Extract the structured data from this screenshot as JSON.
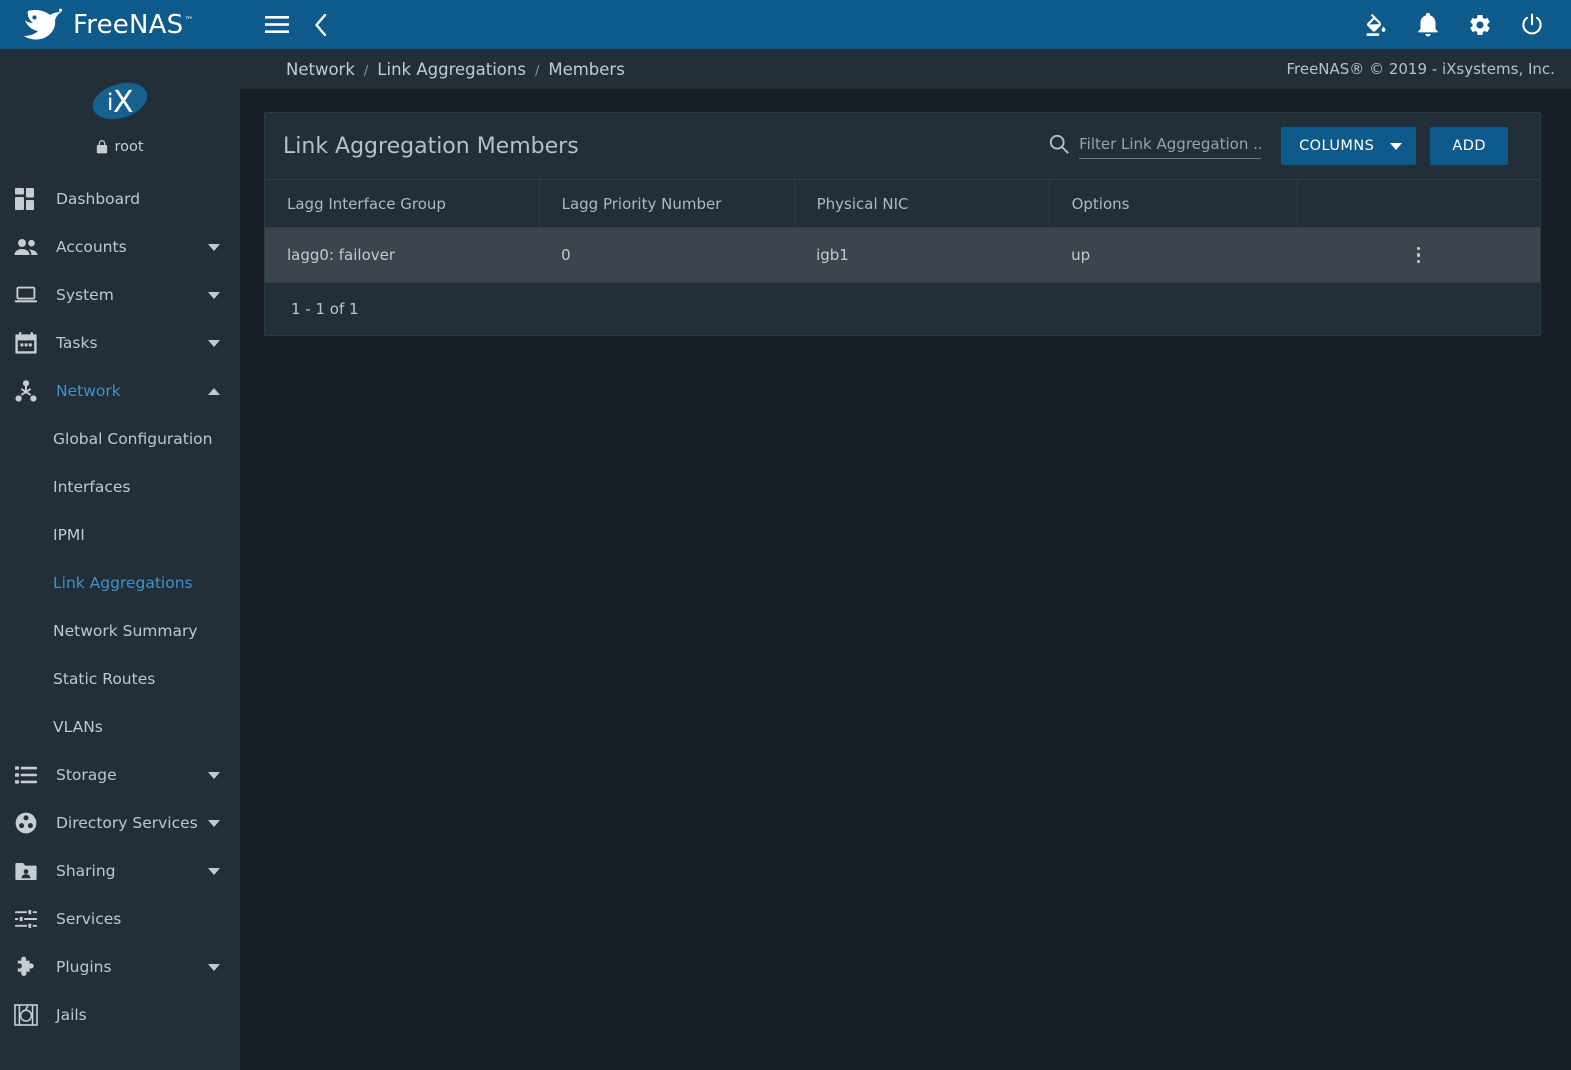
{
  "app": {
    "brand_name": "FreeNAS",
    "brand_tm": "™",
    "logo_icon": "freenas-shark-logo"
  },
  "topbar": {
    "menu_icon": "hamburger-menu-icon",
    "back_icon": "chevron-left-icon",
    "icons": [
      {
        "name": "theme-paint-bucket-icon",
        "label": "Change Theme"
      },
      {
        "name": "notifications-bell-icon",
        "label": "Notifications"
      },
      {
        "name": "settings-gear-icon",
        "label": "Settings"
      },
      {
        "name": "power-icon",
        "label": "Power"
      }
    ]
  },
  "sidebar": {
    "avatar_icon": "ix-systems-logo",
    "avatar_text": "iX",
    "lock_icon": "lock-icon",
    "username": "root",
    "items": [
      {
        "label": "Dashboard",
        "icon": "dashboard-icon",
        "expandable": false,
        "active": false
      },
      {
        "label": "Accounts",
        "icon": "accounts-people-icon",
        "expandable": true,
        "expanded": false,
        "active": false
      },
      {
        "label": "System",
        "icon": "system-laptop-icon",
        "expandable": true,
        "expanded": false,
        "active": false
      },
      {
        "label": "Tasks",
        "icon": "tasks-calendar-icon",
        "expandable": true,
        "expanded": false,
        "active": false
      },
      {
        "label": "Network",
        "icon": "network-share-icon",
        "expandable": true,
        "expanded": true,
        "active": true
      },
      {
        "label": "Storage",
        "icon": "storage-list-icon",
        "expandable": true,
        "expanded": false,
        "active": false
      },
      {
        "label": "Directory Services",
        "icon": "directory-services-icon",
        "expandable": true,
        "expanded": false,
        "active": false
      },
      {
        "label": "Sharing",
        "icon": "sharing-folder-icon",
        "expandable": true,
        "expanded": false,
        "active": false
      },
      {
        "label": "Services",
        "icon": "services-sliders-icon",
        "expandable": false,
        "active": false
      },
      {
        "label": "Plugins",
        "icon": "plugins-puzzle-icon",
        "expandable": true,
        "expanded": false,
        "active": false
      },
      {
        "label": "Jails",
        "icon": "jails-icon",
        "expandable": false,
        "active": false
      }
    ],
    "network_submenu": [
      {
        "label": "Global Configuration",
        "active": false
      },
      {
        "label": "Interfaces",
        "active": false
      },
      {
        "label": "IPMI",
        "active": false
      },
      {
        "label": "Link Aggregations",
        "active": true
      },
      {
        "label": "Network Summary",
        "active": false
      },
      {
        "label": "Static Routes",
        "active": false
      },
      {
        "label": "VLANs",
        "active": false
      }
    ]
  },
  "breadcrumb": {
    "items": [
      "Network",
      "Link Aggregations",
      "Members"
    ],
    "separator": "/"
  },
  "footer": {
    "copyright": "FreeNAS® © 2019 - iXsystems, Inc."
  },
  "card": {
    "title": "Link Aggregation Members",
    "search": {
      "icon": "search-icon",
      "placeholder": "Filter Link Aggregation ...",
      "value": ""
    },
    "columns_button": "COLUMNS",
    "add_button": "ADD"
  },
  "table": {
    "headers": [
      "Lagg Interface Group",
      "Lagg Priority Number",
      "Physical NIC",
      "Options",
      ""
    ],
    "rows": [
      {
        "lagg_interface_group": "lagg0: failover",
        "lagg_priority_number": "0",
        "physical_nic": "igb1",
        "options": "up",
        "actions_icon": "kebab-menu-icon"
      }
    ],
    "pagination_label": "1 - 1 of 1"
  },
  "colors": {
    "accent_blue": "#0e5a8a",
    "link_blue": "#3f93c8",
    "page_bg": "#171e26",
    "panel_bg": "#222e38",
    "row_bg": "#3c444e",
    "text_primary": "#c3cbd3"
  }
}
